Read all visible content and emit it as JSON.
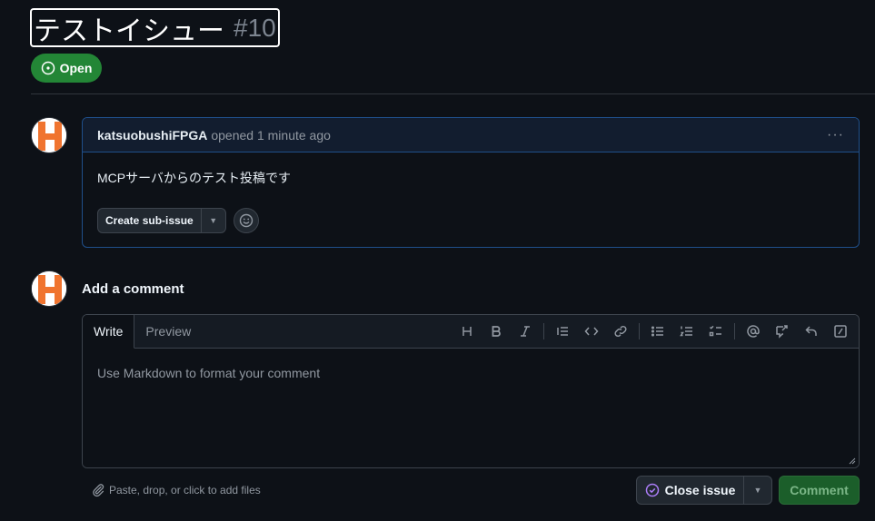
{
  "issue": {
    "title": "テストイシュー",
    "number": "#10",
    "state": "Open"
  },
  "comment": {
    "author": "katsuobushiFPGA",
    "opened_text": "opened 1 minute ago",
    "body": "MCPサーバからのテスト投稿です",
    "create_sub_issue_label": "Create sub-issue"
  },
  "add_comment": {
    "heading": "Add a comment",
    "tabs": [
      "Write",
      "Preview"
    ],
    "placeholder": "Use Markdown to format your comment",
    "attach_text": "Paste, drop, or click to add files",
    "close_issue_label": "Close issue",
    "comment_button_label": "Comment"
  },
  "toolbar_icons": [
    "heading-icon",
    "bold-icon",
    "italic-icon",
    "quote-icon",
    "code-icon",
    "link-icon",
    "unordered-list-icon",
    "ordered-list-icon",
    "task-list-icon",
    "mention-icon",
    "reference-icon",
    "saved-reply-icon",
    "slash-command-icon"
  ],
  "colors": {
    "background": "#0d1117",
    "open_green": "#238636",
    "accent_border": "#1f4f8a",
    "close_issue_purple": "#ab7df8",
    "avatar_orange": "#f0742f"
  }
}
